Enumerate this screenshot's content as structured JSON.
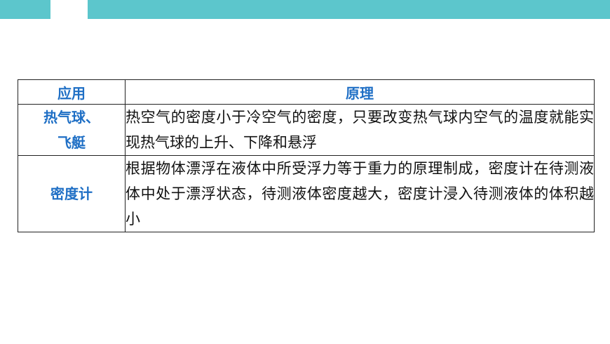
{
  "header": {
    "accent_color": "#5cc6cc"
  },
  "table": {
    "headers": [
      "应用",
      "原理"
    ],
    "rows": [
      {
        "application_lines": [
          "热气球、",
          "飞艇"
        ],
        "principle": "热空气的密度小于冷空气的密度，只要改变热气球内空气的温度就能实现热气球的上升、下降和悬浮"
      },
      {
        "application_lines": [
          "密度计"
        ],
        "principle": "根据物体漂浮在液体中所受浮力等于重力的原理制成，密度计在待测液体中处于漂浮状态，待测液体密度越大，密度计浸入待测液体的体积越小"
      }
    ]
  }
}
